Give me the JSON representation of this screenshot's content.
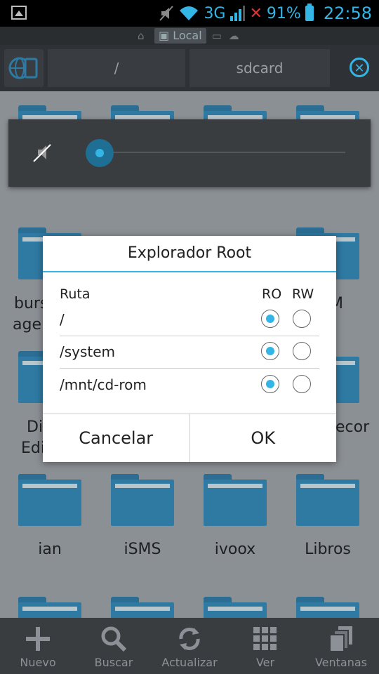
{
  "status": {
    "network": "3G",
    "battery": "91%",
    "time": "22:58"
  },
  "storage_tabs": {
    "local": "Local"
  },
  "path": {
    "root": "/",
    "current": "sdcard"
  },
  "folders": [
    {
      "label": "burs"
    },
    {
      "label": "agei"
    },
    {
      "label": "M"
    },
    {
      "label": "Di"
    },
    {
      "label": "Edi"
    },
    {
      "label": "ecor"
    },
    {
      "label": "ian"
    },
    {
      "label": "iSMS"
    },
    {
      "label": "ivoox"
    },
    {
      "label": "Libros"
    }
  ],
  "dialog": {
    "title": "Explorador Root",
    "col_path": "Ruta",
    "col_ro": "RO",
    "col_rw": "RW",
    "rows": [
      {
        "path": "/",
        "ro": true,
        "rw": false
      },
      {
        "path": "/system",
        "ro": true,
        "rw": false
      },
      {
        "path": "/mnt/cd-rom",
        "ro": true,
        "rw": false
      }
    ],
    "cancel": "Cancelar",
    "ok": "OK"
  },
  "toolbar": {
    "new": "Nuevo",
    "search": "Buscar",
    "refresh": "Actualizar",
    "view": "Ver",
    "windows": "Ventanas"
  }
}
